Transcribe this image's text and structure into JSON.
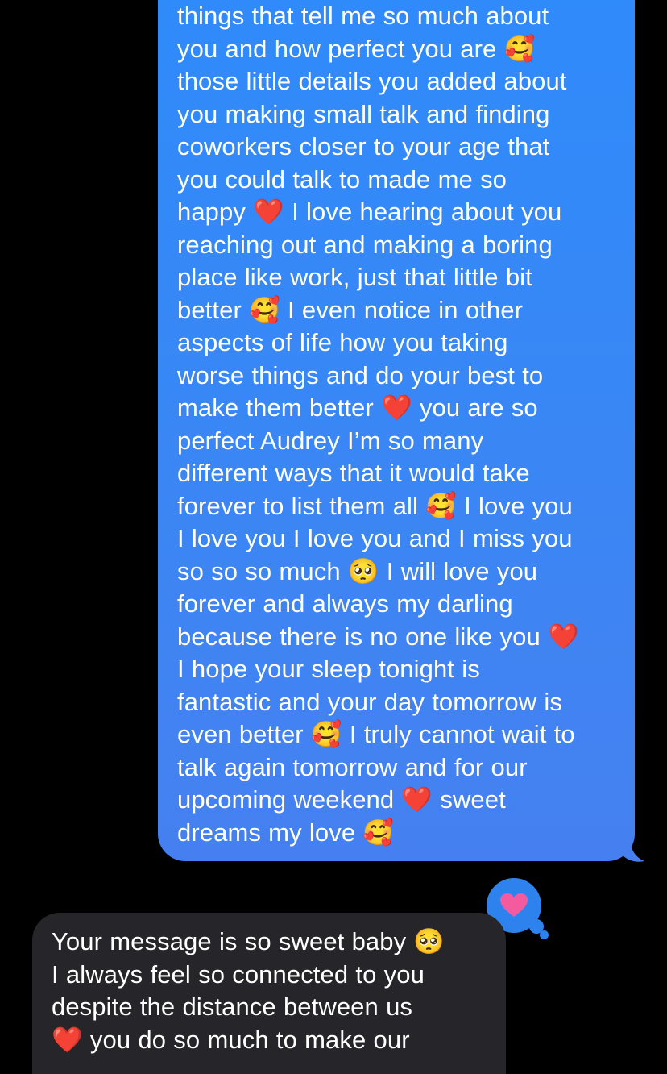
{
  "sent_message": {
    "lines": [
      "things that tell me so much about",
      "you and how perfect you are 🥰",
      "those little details you added about",
      "you making small talk and finding",
      "coworkers closer to your age that",
      "you could talk to made me so",
      "happy ❤️ I love hearing about you",
      "reaching out and making a boring",
      "place like work, just that little bit",
      "better 🥰 I even notice in other",
      "aspects of life how you taking",
      "worse things and do your best to",
      "make them better ❤️ you are so",
      "perfect Audrey I’m so many",
      "different ways that it would take",
      "forever to list them all 🥰 I love you",
      "I love you I love you and I miss you",
      "so so so much 🥺 I will love you",
      "forever and always my darling",
      "because there is no one like you ❤️",
      "I hope your sleep tonight is",
      "fantastic and your day tomorrow is",
      "even better 🥰 I truly cannot wait to",
      "talk again tomorrow and for our",
      "upcoming weekend ❤️ sweet",
      "dreams my love 🥰"
    ],
    "bubble_color": "#3b86f4"
  },
  "reaction": {
    "icon": "heart-icon",
    "heart_color": "#f45b9f",
    "bubble_color": "#2e82ee"
  },
  "received_message": {
    "lines": [
      "Your message is so sweet baby 🥺",
      "I always feel so connected to you",
      "despite the distance between us",
      "❤️ you do so much to make our"
    ],
    "bubble_color": "#26252a"
  }
}
